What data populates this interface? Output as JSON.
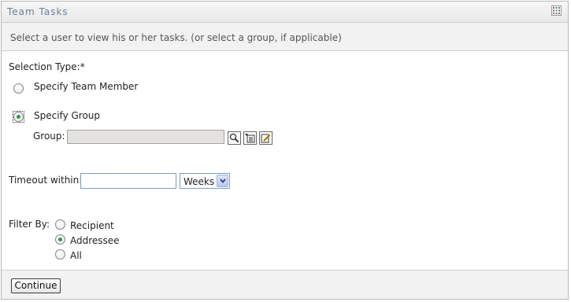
{
  "panel": {
    "title": "Team Tasks",
    "description": "Select a user to view his or her tasks. (or select a group, if applicable)"
  },
  "form": {
    "selection_type_label": "Selection Type:*",
    "options": {
      "team_member": "Specify Team Member",
      "group": "Specify Group"
    },
    "selected_option": "group",
    "group_label": "Group:",
    "group_value": "",
    "timeout_label": "Timeout within:",
    "timeout_value": "",
    "timeout_unit": "Weeks",
    "filter_label": "Filter By:",
    "filter_options": [
      "Recipient",
      "Addressee",
      "All"
    ],
    "filter_selected": "Addressee"
  },
  "icons": {
    "panel_menu": "grid-menu-icon",
    "group_search": "search-icon",
    "group_history": "history-list-icon",
    "group_clear": "clear-edit-icon",
    "dropdown": "chevron-down-icon"
  },
  "footer": {
    "continue_label": "Continue"
  },
  "colors": {
    "title_text": "#6b7f9a",
    "selected_radio": "#2f9a36",
    "bar_background": "#f2f2f2"
  }
}
